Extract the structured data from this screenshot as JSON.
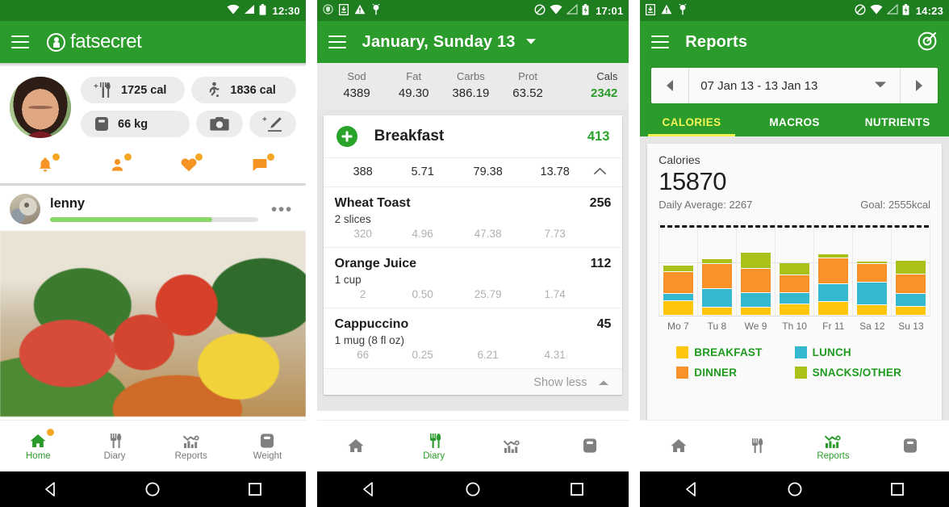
{
  "panel1": {
    "statusbar": {
      "time": "12:30",
      "icons": [
        "wifi-icon",
        "signal-icon",
        "battery-icon"
      ]
    },
    "appbar": {
      "menu_icon": "hamburger-icon",
      "logo_text": "fatsecret"
    },
    "chips": [
      {
        "icon": "food-add-icon",
        "value": "1725 cal"
      },
      {
        "icon": "exercise-icon",
        "value": "1836 cal"
      },
      {
        "icon": "scale-icon",
        "value": "66 kg"
      },
      {
        "icon": "camera-icon",
        "value": ""
      },
      {
        "icon": "edit-add-icon",
        "value": ""
      }
    ],
    "social": [
      {
        "icon": "bell-icon",
        "badge": true
      },
      {
        "icon": "person-icon",
        "badge": true
      },
      {
        "icon": "heart-icon",
        "badge": true
      },
      {
        "icon": "comment-icon",
        "badge": true
      }
    ],
    "feed": {
      "username": "lenny",
      "progress_percent": 78,
      "more_icon": "more-horizontal-icon"
    },
    "bottomnav": [
      {
        "label": "Home",
        "icon": "home-icon",
        "active": true,
        "badge": true
      },
      {
        "label": "Diary",
        "icon": "cutlery-icon",
        "active": false,
        "badge": false
      },
      {
        "label": "Reports",
        "icon": "reports-icon",
        "active": false,
        "badge": false
      },
      {
        "label": "Weight",
        "icon": "scale-icon",
        "active": false,
        "badge": false
      }
    ]
  },
  "panel2": {
    "statusbar": {
      "time": "17:01",
      "left_icons": [
        "shield-icon",
        "download-icon",
        "warning-icon",
        "android-icon"
      ],
      "right_icons": [
        "mute-icon",
        "wifi-icon",
        "signal-icon",
        "battery-charging-icon"
      ]
    },
    "appbar": {
      "menu_icon": "hamburger-icon",
      "title": "January, Sunday 13",
      "caret_icon": "chevron-down-icon"
    },
    "nutrition_headers": [
      "Sod",
      "Fat",
      "Carbs",
      "Prot",
      "Cals"
    ],
    "nutrition_values": [
      "4389",
      "49.30",
      "386.19",
      "63.52",
      "2342"
    ],
    "meal": {
      "add_icon": "plus-circle-icon",
      "name": "Breakfast",
      "calories": "413",
      "macros": [
        "388",
        "5.71",
        "79.38",
        "13.78"
      ],
      "collapse_icon": "chevron-up-icon"
    },
    "foods": [
      {
        "name": "Wheat Toast",
        "calories": "256",
        "serving": "2 slices",
        "macros": [
          "320",
          "4.96",
          "47.38",
          "7.73"
        ]
      },
      {
        "name": "Orange Juice",
        "calories": "112",
        "serving": "1 cup",
        "macros": [
          "2",
          "0.50",
          "25.79",
          "1.74"
        ]
      },
      {
        "name": "Cappuccino",
        "calories": "45",
        "serving": "1 mug (8 fl oz)",
        "macros": [
          "66",
          "0.25",
          "6.21",
          "4.31"
        ]
      }
    ],
    "show_less": {
      "label": "Show less",
      "icon": "chevron-up-icon"
    },
    "bottomnav": [
      {
        "label": "",
        "icon": "home-icon",
        "active": false
      },
      {
        "label": "Diary",
        "icon": "cutlery-icon",
        "active": true
      },
      {
        "label": "",
        "icon": "reports-icon",
        "active": false
      },
      {
        "label": "",
        "icon": "scale-icon",
        "active": false
      }
    ]
  },
  "panel3": {
    "statusbar": {
      "time": "14:23",
      "left_icons": [
        "download-icon",
        "warning-icon",
        "android-icon"
      ],
      "right_icons": [
        "mute-icon",
        "wifi-icon",
        "signal-icon",
        "battery-charging-icon"
      ]
    },
    "appbar": {
      "menu_icon": "hamburger-icon",
      "title": "Reports",
      "action_icon": "target-icon"
    },
    "daterange": {
      "prev_icon": "triangle-left-icon",
      "text": "07 Jan 13 - 13 Jan 13",
      "caret_icon": "chevron-down-icon",
      "next_icon": "triangle-right-icon"
    },
    "tabs": [
      {
        "label": "CALORIES",
        "active": true
      },
      {
        "label": "MACROS",
        "active": false
      },
      {
        "label": "NUTRIENTS",
        "active": false
      }
    ],
    "card": {
      "title": "Calories",
      "total": "15870",
      "daily_average": "Daily Average: 2267",
      "goal": "Goal: 2555kcal"
    },
    "bottomnav": [
      {
        "label": "",
        "icon": "home-icon",
        "active": false
      },
      {
        "label": "",
        "icon": "cutlery-icon",
        "active": false
      },
      {
        "label": "Reports",
        "icon": "reports-icon",
        "active": true
      },
      {
        "label": "",
        "icon": "scale-icon",
        "active": false
      }
    ],
    "chart_data": {
      "type": "bar",
      "title": "Calories",
      "subtitle": "Daily Average: 2267",
      "annotation": "Goal: 2555kcal",
      "stacked": true,
      "categories": [
        "Mo 7",
        "Tu 8",
        "We 9",
        "Th 10",
        "Fr 11",
        "Sa 12",
        "Su 13"
      ],
      "series": [
        {
          "name": "BREAKFAST",
          "color": "#ffc60b",
          "values": [
            413,
            225,
            235,
            320,
            395,
            290,
            250
          ]
        },
        {
          "name": "LUNCH",
          "color": "#35b7ce",
          "values": [
            200,
            530,
            400,
            330,
            500,
            640,
            360
          ]
        },
        {
          "name": "DINNER",
          "color": "#f99228",
          "values": [
            630,
            700,
            700,
            490,
            740,
            530,
            560
          ]
        },
        {
          "name": "SNACKS/OTHER",
          "color": "#abc119",
          "values": [
            180,
            150,
            450,
            350,
            110,
            80,
            390
          ]
        }
      ],
      "goal_line": 2555,
      "ylim": [
        0,
        2700
      ],
      "grid": true,
      "legend_position": "bottom",
      "xlabel": "",
      "ylabel": ""
    }
  }
}
